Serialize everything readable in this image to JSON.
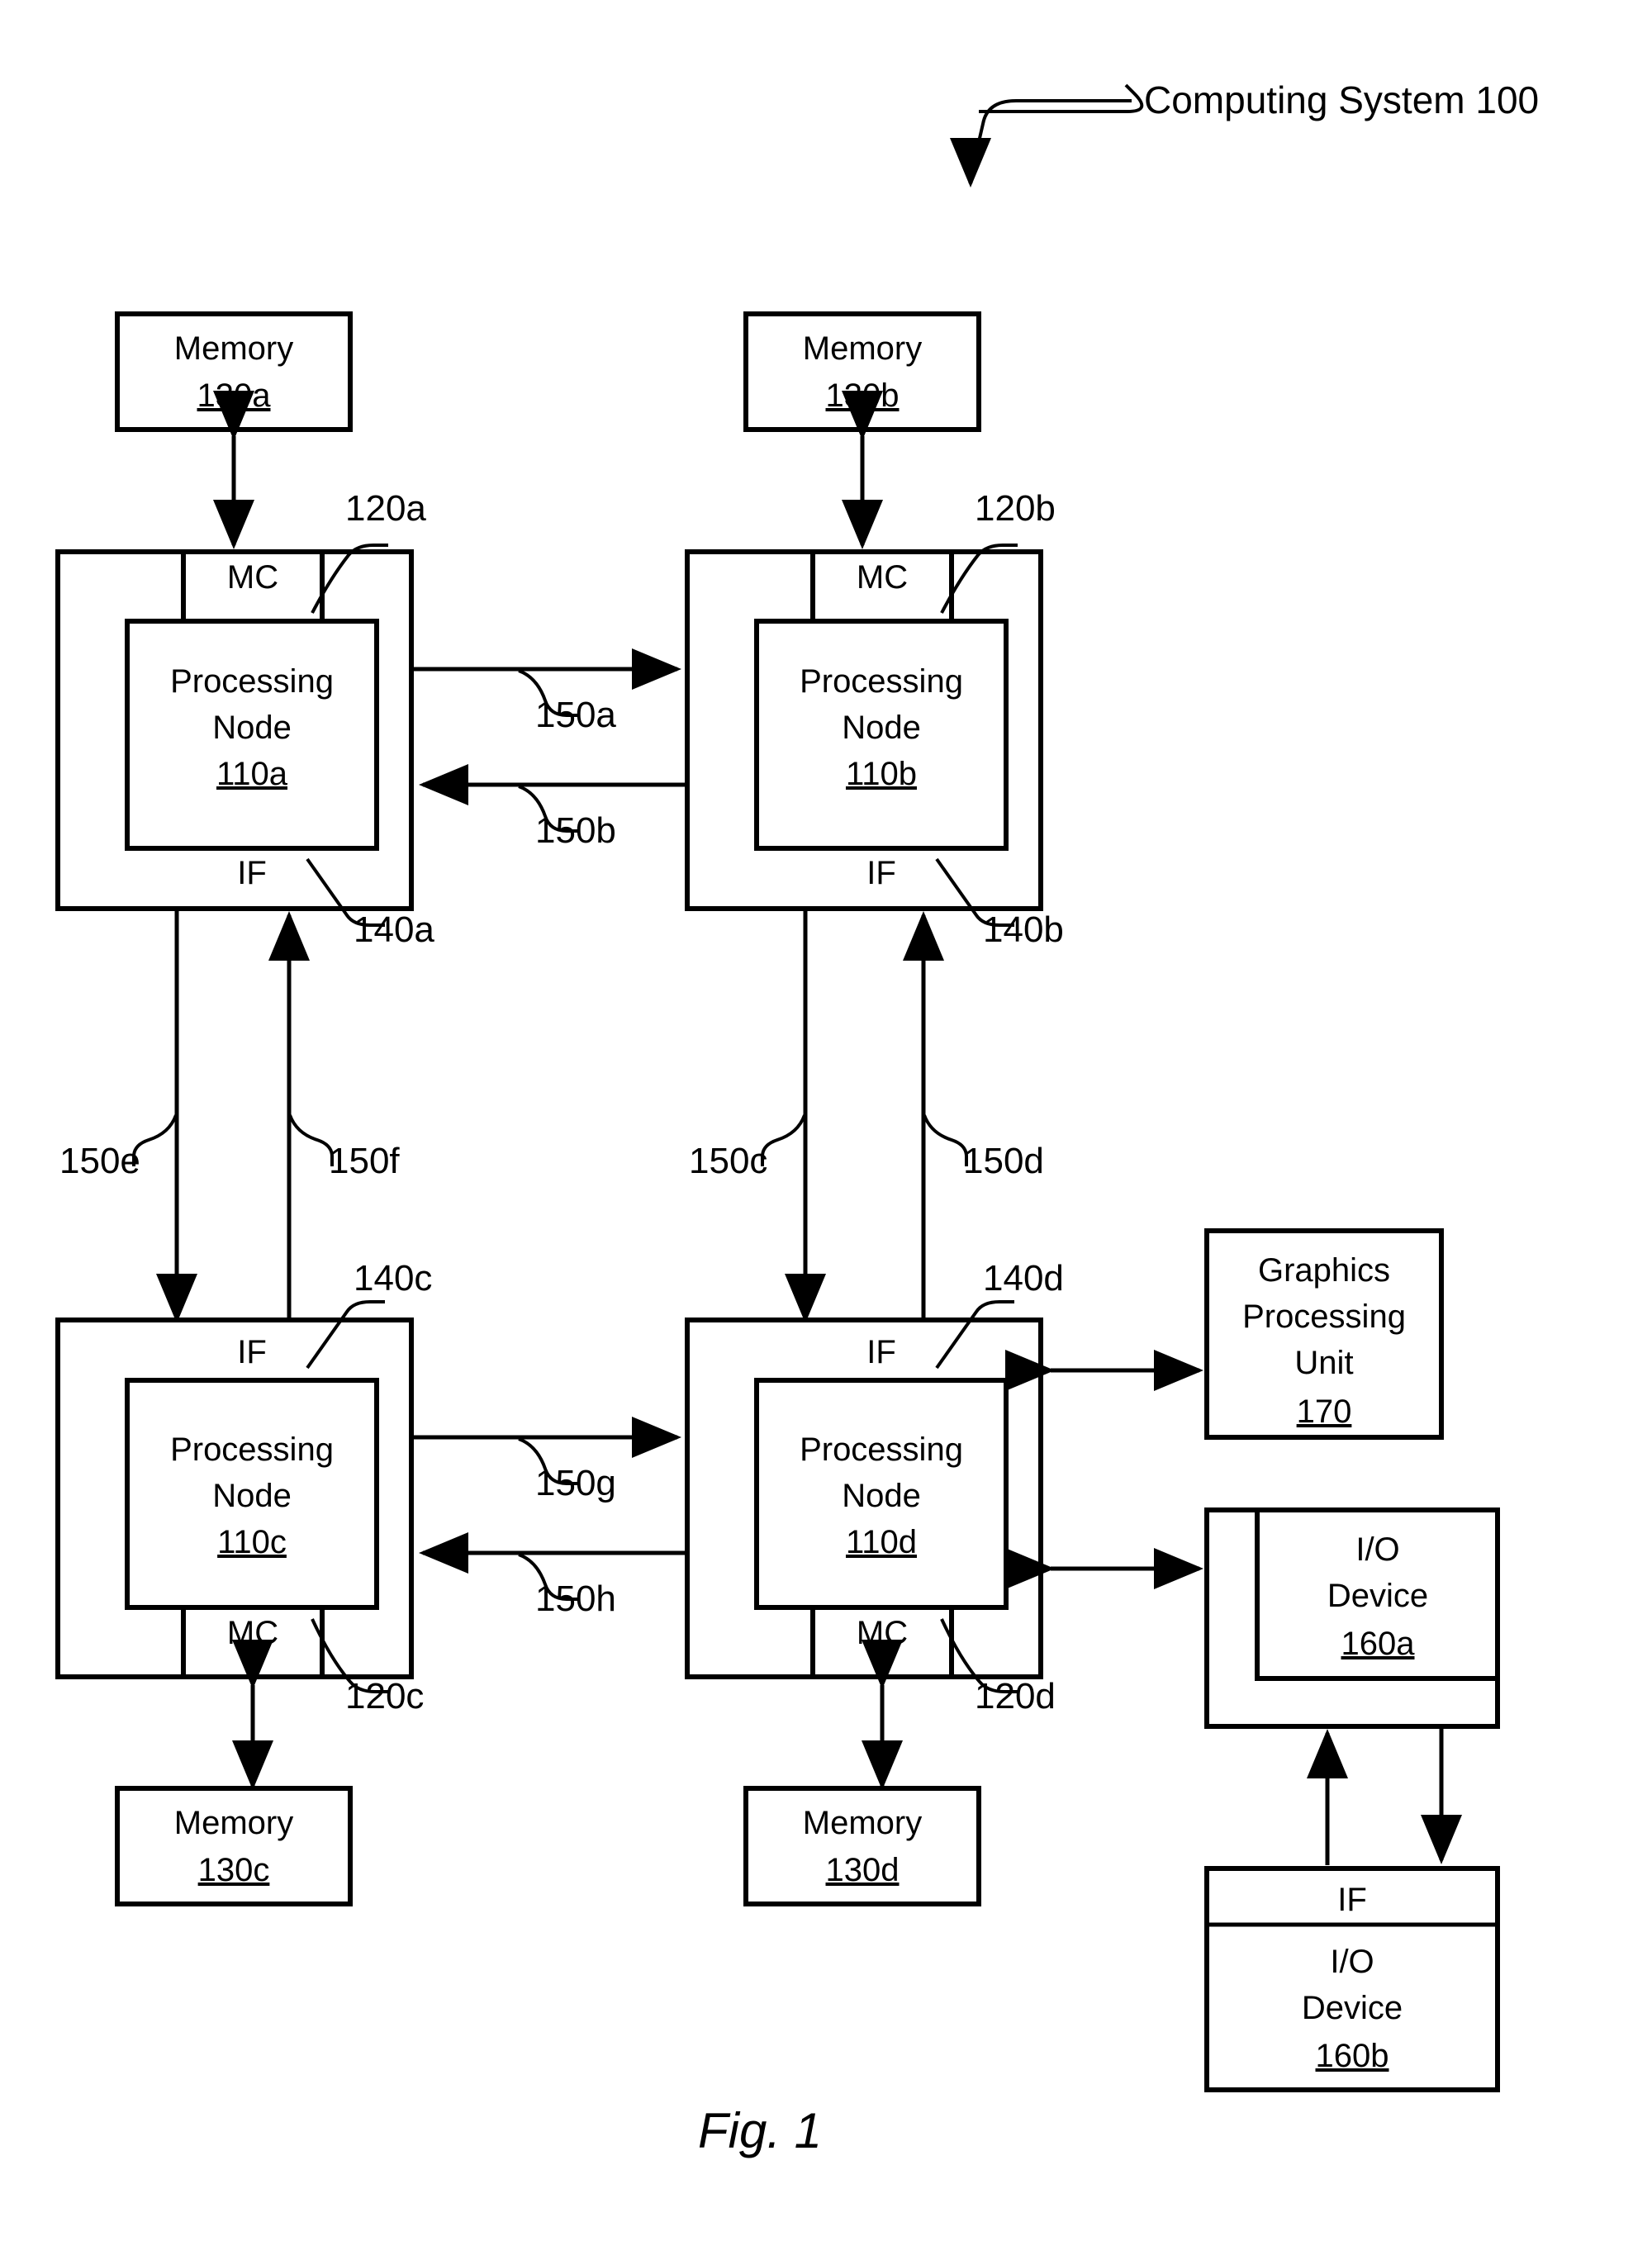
{
  "figure": {
    "title": "Computing System 100",
    "caption": "Fig. 1"
  },
  "labels": {
    "memory": "Memory",
    "processing_node": "Processing Node",
    "processing_node_l1": "Processing",
    "processing_node_l2": "Node",
    "mc": "MC",
    "if": "IF",
    "gpu_l1": "Graphics",
    "gpu_l2": "Processing",
    "gpu_l3": "Unit",
    "io_l1": "I/O",
    "io_l2": "Device"
  },
  "blocks": {
    "memory_130a": {
      "name": "Memory",
      "ref": "130a"
    },
    "memory_130b": {
      "name": "Memory",
      "ref": "130b"
    },
    "memory_130c": {
      "name": "Memory",
      "ref": "130c"
    },
    "memory_130d": {
      "name": "Memory",
      "ref": "130d"
    },
    "node_110a": {
      "name": "Processing Node",
      "ref": "110a",
      "mc": "MC",
      "if": "IF"
    },
    "node_110b": {
      "name": "Processing Node",
      "ref": "110b",
      "mc": "MC",
      "if": "IF"
    },
    "node_110c": {
      "name": "Processing Node",
      "ref": "110c",
      "mc": "MC",
      "if": "IF"
    },
    "node_110d": {
      "name": "Processing Node",
      "ref": "110d",
      "mc": "MC",
      "if": "IF"
    },
    "gpu_170": {
      "name": "Graphics Processing Unit",
      "ref": "170"
    },
    "io_160a": {
      "name": "I/O Device",
      "ref": "160a"
    },
    "io_160b": {
      "name": "I/O Device",
      "ref": "160b",
      "if": "IF"
    }
  },
  "refs": {
    "mc_120a": "120a",
    "mc_120b": "120b",
    "mc_120c": "120c",
    "mc_120d": "120d",
    "if_140a": "140a",
    "if_140b": "140b",
    "if_140c": "140c",
    "if_140d": "140d",
    "link_150a": "150a",
    "link_150b": "150b",
    "link_150c": "150c",
    "link_150d": "150d",
    "link_150e": "150e",
    "link_150f": "150f",
    "link_150g": "150g",
    "link_150h": "150h"
  },
  "colors": {
    "stroke": "#000000",
    "background": "#ffffff"
  }
}
